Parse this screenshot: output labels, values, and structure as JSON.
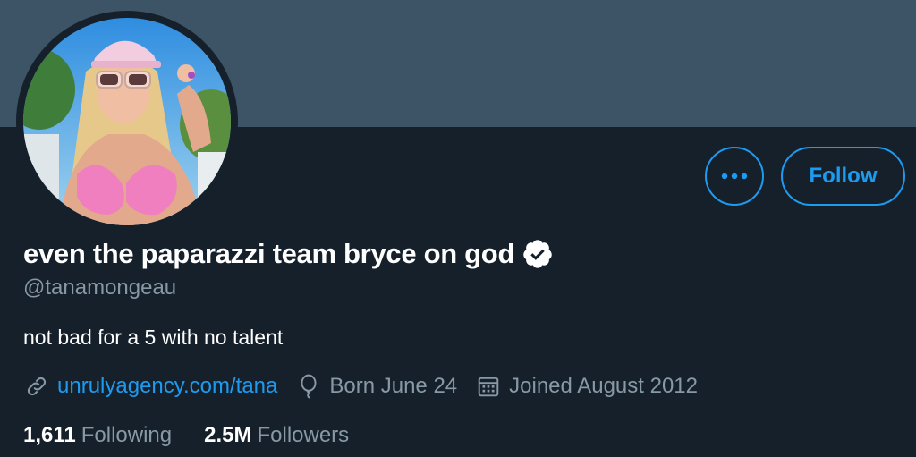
{
  "profile": {
    "display_name": "even the paparazzi team bryce on god",
    "handle": "@tanamongeau",
    "bio": "not bad for a 5 with no talent",
    "verified": true,
    "avatar_icon": "profile-photo",
    "website": "unrulyagency.com/tana",
    "birthday": "Born June 24",
    "joined": "Joined August 2012"
  },
  "actions": {
    "more_icon": "ellipsis-icon",
    "follow_label": "Follow"
  },
  "stats": {
    "following_count": "1,611",
    "following_label": "Following",
    "followers_count": "2.5M",
    "followers_label": "Followers"
  },
  "colors": {
    "background": "#15202b",
    "banner": "#3d5466",
    "accent": "#1d9bf0",
    "secondary_text": "#8899a6"
  }
}
